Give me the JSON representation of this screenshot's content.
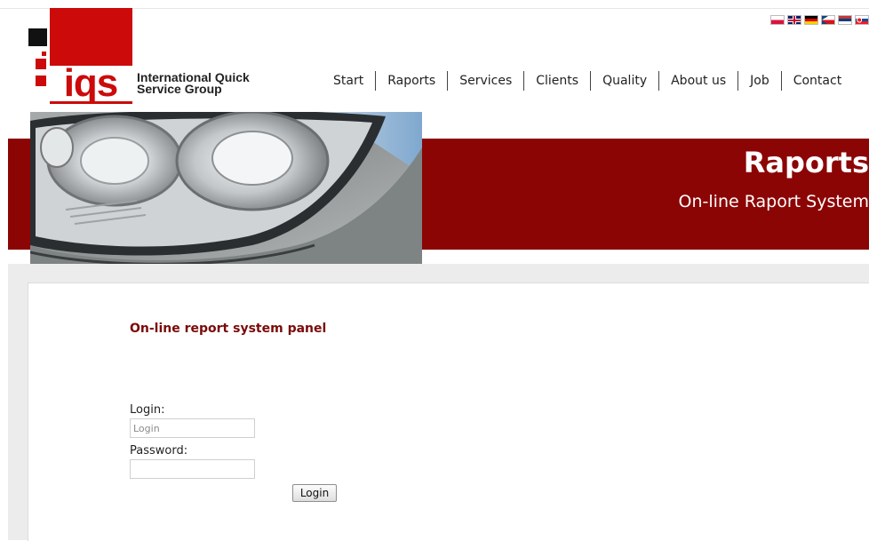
{
  "logo": {
    "word": "iqs",
    "name_line1": "International Quick",
    "name_line2": "Service Group"
  },
  "flags": [
    {
      "name": "pl-flag-icon",
      "colors": [
        "#ffffff",
        "#dc143c"
      ]
    },
    {
      "name": "uk-flag-icon",
      "colors": [
        "#012169",
        "#c8102e"
      ]
    },
    {
      "name": "de-flag-icon",
      "colors": [
        "#000000",
        "#dd0000",
        "#ffce00"
      ]
    },
    {
      "name": "cz-flag-icon",
      "colors": [
        "#ffffff",
        "#d7141a",
        "#11457e"
      ]
    },
    {
      "name": "rs-flag-icon",
      "colors": [
        "#c6363c",
        "#0c4076",
        "#ffffff"
      ]
    },
    {
      "name": "sk-flag-icon",
      "colors": [
        "#ffffff",
        "#0b4ea2",
        "#ee1c25"
      ]
    }
  ],
  "nav": {
    "items": [
      "Start",
      "Raports",
      "Services",
      "Clients",
      "Quality",
      "About us",
      "Job",
      "Contact"
    ]
  },
  "banner": {
    "title": "Raports",
    "subtitle": "On-line Raport System"
  },
  "panel": {
    "title": "On-line report system panel",
    "login_label": "Login:",
    "login_placeholder": "Login",
    "password_label": "Password:",
    "submit_label": "Login"
  },
  "colors": {
    "brand_red": "#cc0a0a",
    "banner_red": "#8c0505",
    "title_red": "#7a0a0a"
  }
}
